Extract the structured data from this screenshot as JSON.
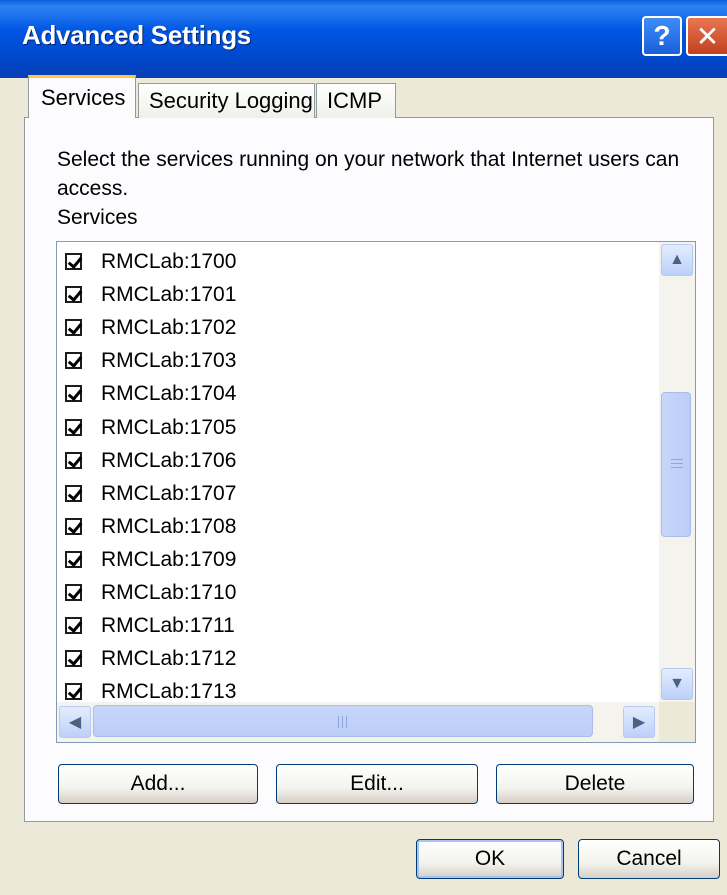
{
  "window": {
    "title": "Advanced Settings",
    "help_glyph": "?",
    "close_glyph": "✕"
  },
  "tabs": [
    {
      "label": "Services",
      "active": true
    },
    {
      "label": "Security Logging",
      "active": false
    },
    {
      "label": "ICMP",
      "active": false
    }
  ],
  "services_tab": {
    "description": "Select the services running on your network that Internet users can access.",
    "list_label": "Services",
    "items": [
      {
        "label": "RMCLab:1700",
        "checked": true
      },
      {
        "label": "RMCLab:1701",
        "checked": true
      },
      {
        "label": "RMCLab:1702",
        "checked": true
      },
      {
        "label": "RMCLab:1703",
        "checked": true
      },
      {
        "label": "RMCLab:1704",
        "checked": true
      },
      {
        "label": "RMCLab:1705",
        "checked": true
      },
      {
        "label": "RMCLab:1706",
        "checked": true
      },
      {
        "label": "RMCLab:1707",
        "checked": true
      },
      {
        "label": "RMCLab:1708",
        "checked": true
      },
      {
        "label": "RMCLab:1709",
        "checked": true
      },
      {
        "label": "RMCLab:1710",
        "checked": true
      },
      {
        "label": "RMCLab:1711",
        "checked": true
      },
      {
        "label": "RMCLab:1712",
        "checked": true
      },
      {
        "label": "RMCLab:1713",
        "checked": true
      }
    ],
    "buttons": {
      "add": "Add...",
      "edit": "Edit...",
      "delete": "Delete"
    }
  },
  "footer": {
    "ok": "OK",
    "cancel": "Cancel"
  },
  "colors": {
    "titlebar": "#0054E3",
    "active_tab_accent": "#FFC83C",
    "dialog_bg": "#ECE9D8"
  }
}
